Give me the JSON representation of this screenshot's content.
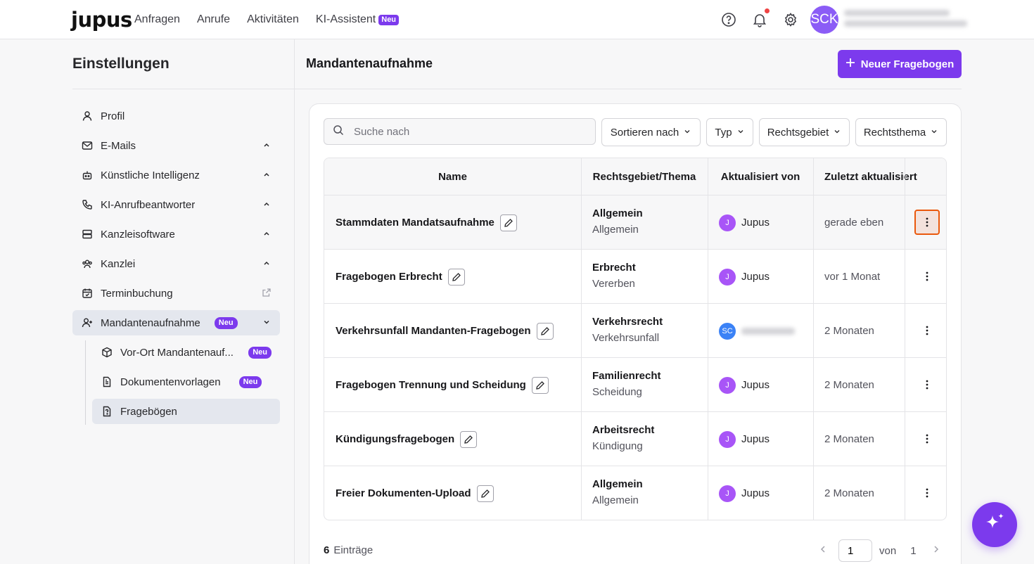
{
  "topbar": {
    "logo": "jupus",
    "nav": [
      "Anfragen",
      "Anrufe",
      "Aktivitäten",
      "KI-Assistent"
    ],
    "nav_badge": "Neu",
    "avatar_initials": "SCK",
    "icons": [
      "help-icon",
      "bell-icon",
      "gear-icon"
    ]
  },
  "sidebar": {
    "title": "Einstellungen",
    "items": [
      {
        "label": "Profil",
        "icon": "user-icon"
      },
      {
        "label": "E-Mails",
        "icon": "mail-icon"
      },
      {
        "label": "Künstliche Intelligenz",
        "icon": "robot-icon"
      },
      {
        "label": "KI-Anrufbeantworter",
        "icon": "phone-icon"
      },
      {
        "label": "Kanzleisoftware",
        "icon": "server-icon"
      },
      {
        "label": "Kanzlei",
        "icon": "team-icon"
      },
      {
        "label": "Terminbuchung",
        "icon": "calendar-icon"
      },
      {
        "label": "Mandantenaufnahme",
        "icon": "user-plus-icon",
        "badge": "Neu"
      }
    ],
    "subitems": [
      {
        "label": "Vor-Ort Mandantenauf...",
        "icon": "box-icon",
        "badge": "Neu"
      },
      {
        "label": "Dokumentenvorlagen",
        "icon": "document-icon",
        "badge": "Neu"
      },
      {
        "label": "Fragebögen",
        "icon": "questionnaire-icon"
      }
    ]
  },
  "main": {
    "title": "Mandantenaufnahme",
    "new_button": "Neuer Fragebogen",
    "search_placeholder": "Suche nach",
    "filters": [
      "Sortieren nach",
      "Typ",
      "Rechtsgebiet",
      "Rechtsthema"
    ],
    "columns": [
      "Name",
      "Rechtsgebiet/Thema",
      "Aktualisiert von",
      "Zuletzt aktualisiert"
    ],
    "rows": [
      {
        "name": "Stammdaten Mandatsaufnahme",
        "area": "Allgemein",
        "topic": "Allgemein",
        "user_initial": "J",
        "user": "Jupus",
        "updated": "gerade eben"
      },
      {
        "name": "Fragebogen Erbrecht",
        "area": "Erbrecht",
        "topic": "Vererben",
        "user_initial": "J",
        "user": "Jupus",
        "updated": "vor 1 Monat"
      },
      {
        "name": "Verkehrsunfall Mandanten-Fragebogen",
        "area": "Verkehrsrecht",
        "topic": "Verkehrsunfall",
        "user_initial": "SC",
        "user": "",
        "updated": "2 Monaten"
      },
      {
        "name": "Fragebogen Trennung und Scheidung",
        "area": "Familienrecht",
        "topic": "Scheidung",
        "user_initial": "J",
        "user": "Jupus",
        "updated": "2 Monaten"
      },
      {
        "name": "Kündigungsfragebogen",
        "area": "Arbeitsrecht",
        "topic": "Kündigung",
        "user_initial": "J",
        "user": "Jupus",
        "updated": "2 Monaten"
      },
      {
        "name": "Freier Dokumenten-Upload",
        "area": "Allgemein",
        "topic": "Allgemein",
        "user_initial": "J",
        "user": "Jupus",
        "updated": "2 Monaten"
      }
    ],
    "footer": {
      "count": "6",
      "count_label": "Einträge",
      "page": "1",
      "of_label": "von",
      "total_pages": "1"
    }
  },
  "colors": {
    "accent": "#7c3aed",
    "focus": "#ea580c",
    "avatar_j": "#a855f7",
    "avatar_sc": "#3b82f6"
  }
}
